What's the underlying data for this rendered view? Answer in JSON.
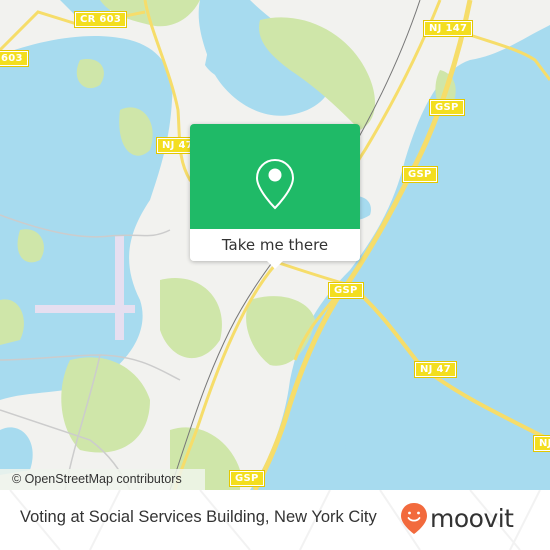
{
  "map": {
    "attribution": "© OpenStreetMap contributors",
    "colors": {
      "land": "#f2f2ef",
      "water": "#a7dbef",
      "park": "#cfe6a9",
      "road": "#f6dd6a",
      "shield": "#f3de1f",
      "airport": "#e6dff0"
    },
    "road_labels": [
      {
        "id": "cr603-top",
        "text": "CR 603"
      },
      {
        "id": "cr603-left",
        "text": "603"
      },
      {
        "id": "nj147",
        "text": "NJ 147"
      },
      {
        "id": "nj47-left",
        "text": "NJ 47"
      },
      {
        "id": "gsp-1",
        "text": "GSP"
      },
      {
        "id": "gsp-2",
        "text": "GSP"
      },
      {
        "id": "gsp-3",
        "text": "GSP"
      },
      {
        "id": "gsp-4",
        "text": "GSP"
      },
      {
        "id": "nj47-right",
        "text": "NJ 47"
      },
      {
        "id": "nj-edge",
        "text": "NJ"
      }
    ]
  },
  "popup": {
    "icon": "map-pin-icon",
    "action_label": "Take me there",
    "accent": "#1fba67"
  },
  "footer": {
    "title": "Voting at Social Services Building, New York City",
    "brand": "moovit",
    "brand_icon": "moovit-smile-pin-icon",
    "brand_color": "#f26a3d"
  }
}
